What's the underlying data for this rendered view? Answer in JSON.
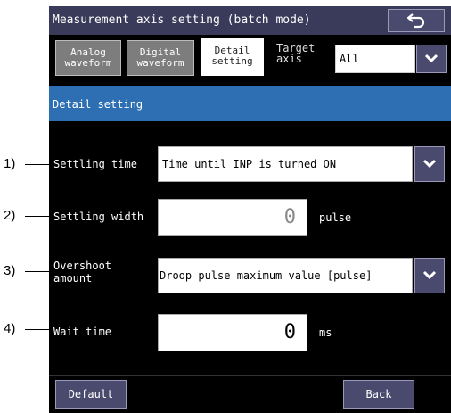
{
  "window": {
    "title": "Measurement axis setting (batch mode)"
  },
  "tabs": [
    {
      "label_line1": "Analog",
      "label_line2": "waveform",
      "active": false
    },
    {
      "label_line1": "Digital",
      "label_line2": "waveform",
      "active": false
    },
    {
      "label_line1": "Detail",
      "label_line2": "setting",
      "active": true
    }
  ],
  "target_axis": {
    "label_line1": "Target",
    "label_line2": "axis",
    "value": "All"
  },
  "section": {
    "title": "Detail setting"
  },
  "settings": {
    "settling_time": {
      "label": "Settling time",
      "value": "Time until INP is turned ON"
    },
    "settling_width": {
      "label": "Settling width",
      "value": "0",
      "unit": "pulse"
    },
    "overshoot_amount": {
      "label_line1": "Overshoot",
      "label_line2": "amount",
      "value": "Droop pulse maximum value [pulse]"
    },
    "wait_time": {
      "label": "Wait time",
      "value": "0",
      "unit": "ms"
    }
  },
  "footer": {
    "default_label": "Default",
    "back_label": "Back"
  },
  "callouts": [
    "1)",
    "2)",
    "3)",
    "4)"
  ],
  "icons": {
    "return": "return-arrow-icon",
    "dropdown": "chevron-down-icon"
  },
  "colors": {
    "screen_bg": "#000000",
    "titlebar": "#3a3a5a",
    "section_header": "#2e6fb4",
    "button_bg": "#4a4a6e",
    "tab_inactive": "#7d7d7d"
  }
}
